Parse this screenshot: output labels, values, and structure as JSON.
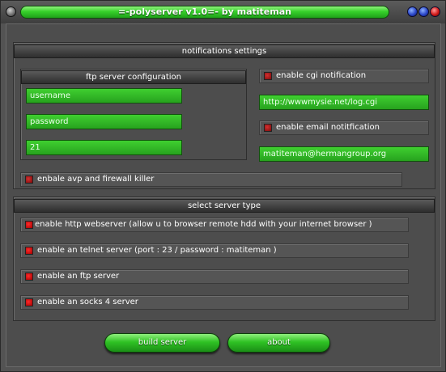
{
  "window": {
    "title": "=-polyserver v1.0=- by matiteman",
    "controls": [
      {
        "name": "minimize",
        "icon": "minimize-icon",
        "color": "#2a46c8"
      },
      {
        "name": "maximize",
        "icon": "maximize-icon",
        "color": "#2a46c8"
      },
      {
        "name": "close",
        "icon": "close-icon",
        "color": "#d01818"
      }
    ]
  },
  "notifications": {
    "header": "notifications settings",
    "ftp": {
      "header": "ftp server configuration",
      "username": "username",
      "password": "password",
      "port": "21"
    },
    "cgi": {
      "label": "enable cgi notification",
      "checked": true
    },
    "cgi_url": "http://wwwmysie.net/log.cgi",
    "email": {
      "label": "enable email notitfication",
      "checked": true
    },
    "email_address": "matiteman@hermangroup.org",
    "avp": {
      "label": "enbale avp and firewall killer",
      "checked": true
    }
  },
  "server_type": {
    "header": "select server type",
    "options": [
      {
        "label": "enable http webserver (allow u to browser remote hdd with your internet browser )",
        "checked": true
      },
      {
        "label": "enable an telnet server (port : 23 / password : matiteman )",
        "checked": true
      },
      {
        "label": "enable an ftp server",
        "checked": true
      },
      {
        "label": "enable an socks 4 server",
        "checked": true
      }
    ]
  },
  "buttons": {
    "build": "build server",
    "about": "about"
  },
  "colors": {
    "accent_green": "#2fc224",
    "checkbox_red": "#d43030",
    "background": "#4d4d4d"
  }
}
